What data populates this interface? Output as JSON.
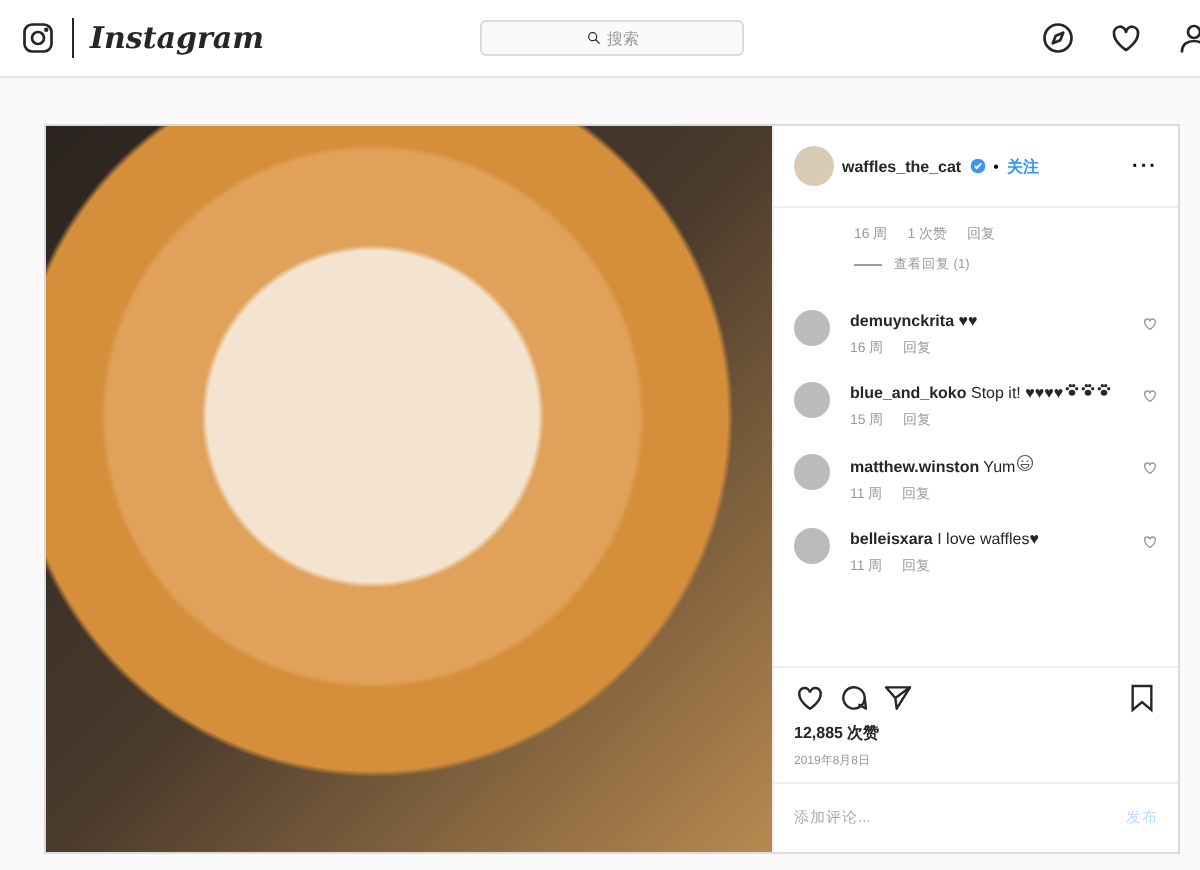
{
  "header": {
    "logo_text": "Instagram",
    "search": {
      "placeholder": "搜索"
    }
  },
  "post": {
    "author": {
      "username": "waffles_the_cat",
      "verified": true,
      "follow": "关注",
      "separator": "•",
      "more": "···"
    },
    "caption_meta": {
      "age": "16 周",
      "likes": "1 次赞",
      "reply": "回复",
      "view_replies": "查看回复 (1)"
    },
    "comments": [
      {
        "username": "demuynckrita",
        "text": "♥♥",
        "age": "16 周",
        "reply": "回复",
        "liked": false
      },
      {
        "username": "blue_and_koko",
        "text": "Stop it! ♥♥♥♥",
        "icons": [
          {
            "kind": "paw"
          },
          {
            "kind": "paw"
          },
          {
            "kind": "paw"
          }
        ],
        "age": "15 周",
        "reply": "回复",
        "liked": false
      },
      {
        "username": "matthew.winston",
        "text": "Yum",
        "icons": [
          {
            "kind": "laugh"
          }
        ],
        "age": "11 周",
        "reply": "回复",
        "liked": false
      },
      {
        "username": "belleisxara",
        "text": "I love waffles♥",
        "age": "11 周",
        "reply": "回复",
        "liked": false
      }
    ],
    "likes": "12,885 次赞",
    "date": "2019年8月8日",
    "liked": false,
    "saved": false,
    "add_comment": {
      "placeholder": "添加评论...",
      "submit": "发布",
      "disabled": true
    }
  }
}
